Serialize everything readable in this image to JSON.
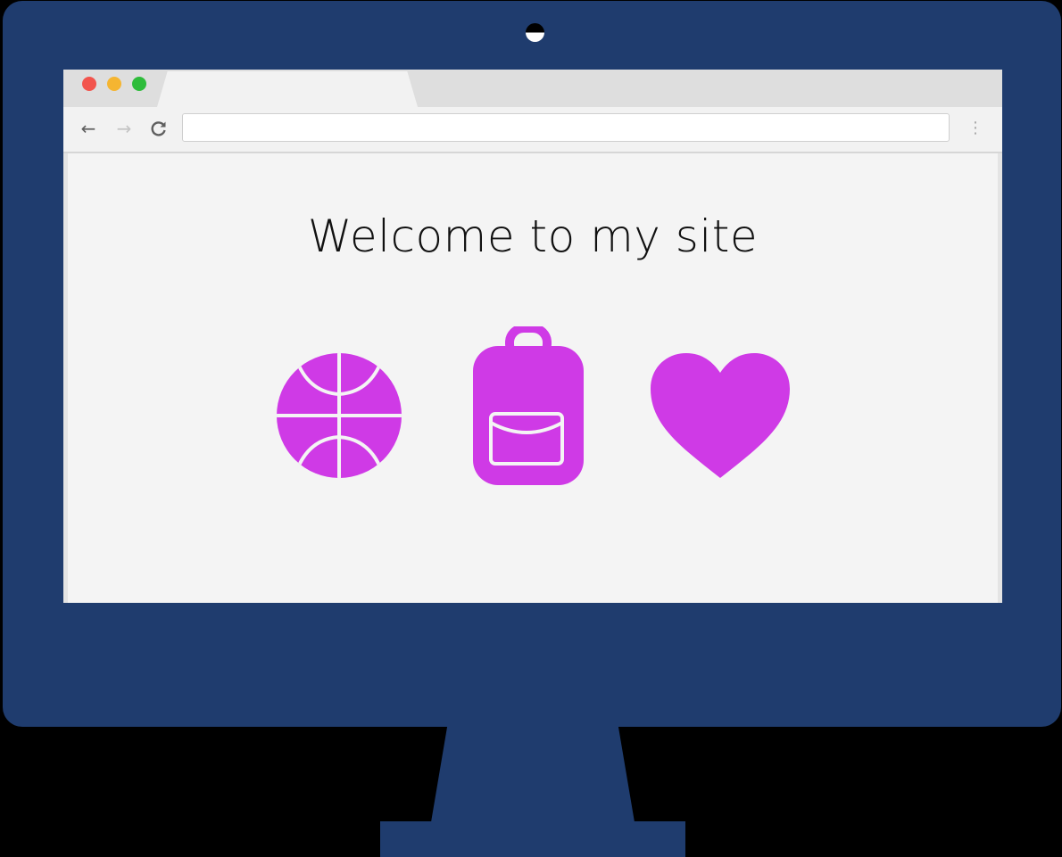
{
  "page": {
    "heading": "Welcome to my site"
  },
  "browser": {
    "address_value": "",
    "back_icon": "arrow-left-icon",
    "forward_icon": "arrow-right-icon",
    "reload_icon": "reload-icon",
    "menu_icon": "more-vertical-icon"
  },
  "icons": [
    {
      "name": "basketball-icon"
    },
    {
      "name": "backpack-icon"
    },
    {
      "name": "heart-icon"
    }
  ],
  "colors": {
    "monitor": "#1f3c6e",
    "accent": "#cf3ae6",
    "background": "#000000"
  }
}
